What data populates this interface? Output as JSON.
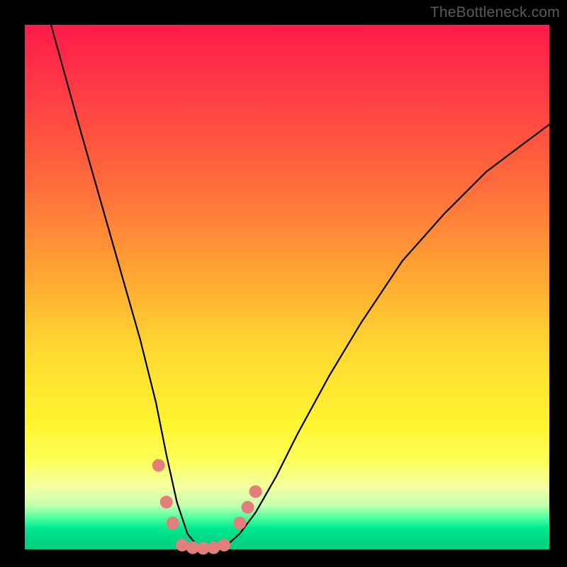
{
  "watermark": "TheBottleneck.com",
  "colors": {
    "frame": "#000000",
    "gradient_top": "#ff1a4b",
    "gradient_mid": "#fff430",
    "gradient_bottom": "#00cf80",
    "curve": "#000000",
    "marker": "#e27f7a"
  },
  "chart_data": {
    "type": "line",
    "title": "",
    "xlabel": "",
    "ylabel": "",
    "xlim": [
      0,
      100
    ],
    "ylim": [
      0,
      100
    ],
    "grid": false,
    "legend": false,
    "note": "V-shaped bottleneck curve. y≈100 means maximum bottleneck (top, red), y≈0 means no bottleneck (bottom, green). Minimum (y≈0) occurs around x≈30–38. Left branch steep, right branch shallower & convex.",
    "series": [
      {
        "name": "bottleneck-curve",
        "x": [
          5,
          10,
          14,
          18,
          22,
          25,
          27,
          29,
          31,
          33,
          35,
          37,
          39,
          41,
          44,
          48,
          52,
          58,
          64,
          72,
          80,
          88,
          96,
          100
        ],
        "y": [
          100,
          82,
          68,
          54,
          40,
          28,
          18,
          9,
          3,
          0.5,
          0,
          0.3,
          1.2,
          3,
          7,
          14,
          22,
          33,
          43,
          55,
          64,
          72,
          78,
          81
        ]
      }
    ],
    "markers": {
      "name": "highlighted-points",
      "note": "Salmon circular markers clustered near the curve minimum, on both walls and along the flat bottom.",
      "points": [
        {
          "x": 25.5,
          "y": 16
        },
        {
          "x": 27.0,
          "y": 9
        },
        {
          "x": 28.2,
          "y": 5
        },
        {
          "x": 30.0,
          "y": 0.8
        },
        {
          "x": 32.0,
          "y": 0.3
        },
        {
          "x": 34.0,
          "y": 0.2
        },
        {
          "x": 36.0,
          "y": 0.3
        },
        {
          "x": 38.0,
          "y": 0.8
        },
        {
          "x": 41.0,
          "y": 5
        },
        {
          "x": 42.5,
          "y": 8
        },
        {
          "x": 44.0,
          "y": 11
        }
      ]
    }
  }
}
